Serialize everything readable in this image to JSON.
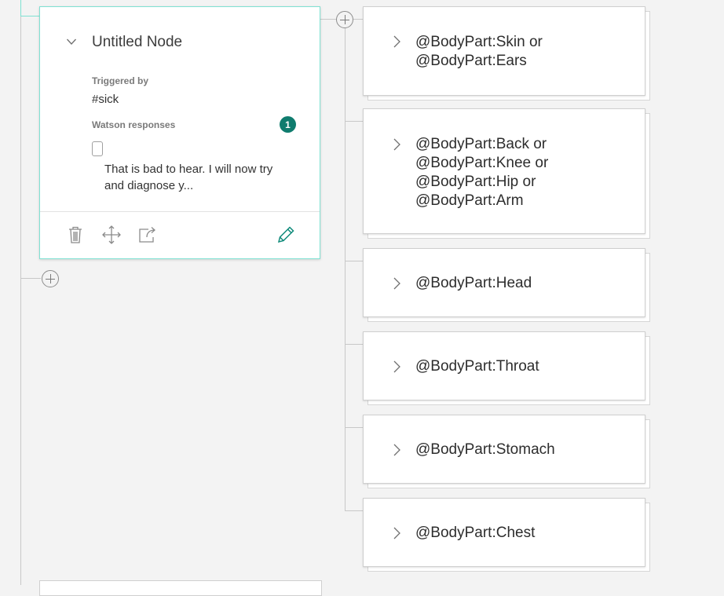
{
  "node": {
    "title": "Untitled Node",
    "triggered_by_label": "Triggered by",
    "trigger": "#sick",
    "responses_label": "Watson responses",
    "responses_count": "1",
    "response_preview": "That is bad to hear. I will now try and diagnose y..."
  },
  "toolbar": {
    "delete_icon": "trash-icon",
    "move_icon": "move-icon",
    "jump_icon": "jump-to-icon",
    "edit_icon": "pencil-icon"
  },
  "children": [
    {
      "condition": "@BodyPart:Skin or\n@BodyPart:Ears"
    },
    {
      "condition": "@BodyPart:Back or\n@BodyPart:Knee or\n@BodyPart:Hip or\n@BodyPart:Arm"
    },
    {
      "condition": "@BodyPart:Head"
    },
    {
      "condition": "@BodyPart:Throat"
    },
    {
      "condition": "@BodyPart:Stomach"
    },
    {
      "condition": "@BodyPart:Chest"
    }
  ],
  "colors": {
    "accent": "#0f7c6e",
    "selected_border": "#7fe1d2",
    "background": "#f3f3f3"
  }
}
